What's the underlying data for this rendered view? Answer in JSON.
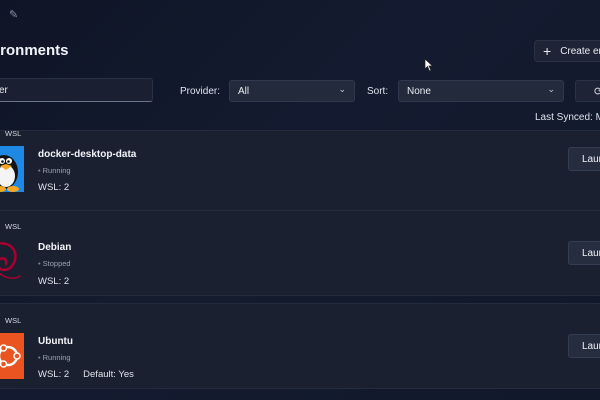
{
  "header": {
    "title": "ironments",
    "create_label": "Create en"
  },
  "filters": {
    "search_value": "er",
    "provider_label": "Provider:",
    "provider_value": "All",
    "sort_label": "Sort:",
    "sort_value": "None",
    "last_synced": "Last Synced: Mo"
  },
  "environments": [
    {
      "tag": "WSL",
      "name": "docker-desktop-data",
      "status": "Running",
      "wsl": "WSL: 2",
      "default": "",
      "launch": "Laun"
    },
    {
      "tag": "WSL",
      "name": "Debian",
      "status": "Stopped",
      "wsl": "WSL: 2",
      "default": "",
      "launch": "Laun"
    },
    {
      "tag": "WSL",
      "name": "Ubuntu",
      "status": "Running",
      "wsl": "WSL: 2",
      "default": "Default: Yes",
      "launch": "Laun"
    }
  ],
  "icons": {
    "tux": "tux-penguin-icon",
    "debian": "debian-swirl-icon",
    "ubuntu": "ubuntu-logo-icon"
  },
  "colors": {
    "background": "#131a2c",
    "card": "#1b2030",
    "ubuntu_orange": "#e95420",
    "debian_red": "#a80030",
    "tux_blue": "#1e88e5"
  }
}
